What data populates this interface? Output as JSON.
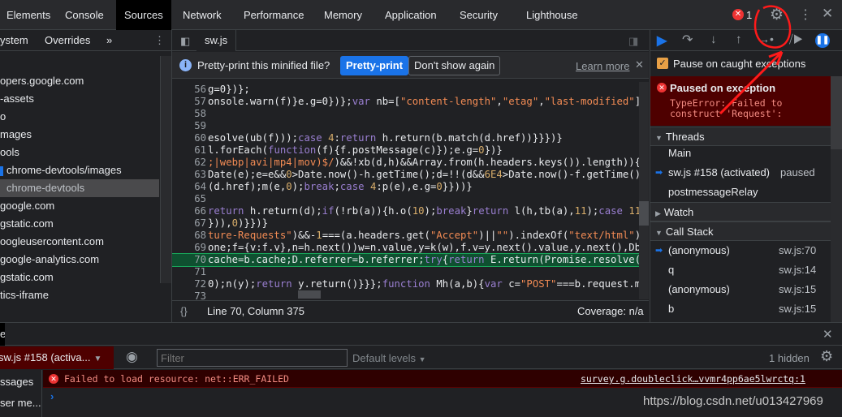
{
  "tabs": [
    "Elements",
    "Console",
    "Sources",
    "Network",
    "Performance",
    "Memory",
    "Application",
    "Security",
    "Lighthouse"
  ],
  "active_tab": "Sources",
  "error_count": "1",
  "navigator": {
    "subtabs": [
      "ystem",
      "Overrides"
    ],
    "more": "»",
    "items": [
      "opers.google.com",
      "-assets",
      "o",
      "mages",
      "ools",
      "chrome-devtools/images",
      "chrome-devtools",
      "google.com",
      "gstatic.com",
      "oogleusercontent.com",
      "google-analytics.com",
      "gstatic.com",
      "tics-iframe"
    ],
    "selected_index": 6
  },
  "editor": {
    "file_tab": "sw.js",
    "infobar": {
      "text": "Pretty-print this minified file?",
      "pretty_print": "Pretty-print",
      "dont_show": "Don't show again",
      "learn_more": "Learn more"
    },
    "lines": [
      {
        "n": "56",
        "t": [
          [
            "g=0})};",
            "ct"
          ]
        ]
      },
      {
        "n": "57",
        "t": [
          [
            "onsole.warn(f)}e.g=0})};",
            "ct"
          ],
          [
            "var ",
            "kw"
          ],
          [
            "nb=[",
            "ct"
          ],
          [
            "\"content-length\"",
            "st"
          ],
          [
            ",",
            "ct"
          ],
          [
            "\"etag\"",
            "st"
          ],
          [
            ",",
            "ct"
          ],
          [
            "\"last-modified\"",
            "st"
          ],
          [
            "]",
            "ct"
          ]
        ]
      },
      {
        "n": "58",
        "t": []
      },
      {
        "n": "59",
        "t": []
      },
      {
        "n": "60",
        "t": [
          [
            "esolve(ub(f)));",
            "ct"
          ],
          [
            "case ",
            "kw"
          ],
          [
            "4",
            "nm"
          ],
          [
            ":",
            "ct"
          ],
          [
            "return ",
            "kw"
          ],
          [
            "h.return(b.match(d.href))}}})}",
            "ct"
          ]
        ]
      },
      {
        "n": "61",
        "t": [
          [
            "l.forEach(",
            "ct"
          ],
          [
            "function",
            "kw"
          ],
          [
            "(f){f.postMessage(c)});e.g=",
            "ct"
          ],
          [
            "0",
            "nm"
          ],
          [
            "})}",
            "ct"
          ]
        ]
      },
      {
        "n": "62",
        "t": [
          [
            ";|webp|avi|mp4|mov)$/",
            "st"
          ],
          [
            ")&&!xb(d,h)&&Array.from(h.headers.keys()).length)){v",
            "ct"
          ]
        ]
      },
      {
        "n": "63",
        "t": [
          [
            "Date(e);e=e&&",
            "ct"
          ],
          [
            "0",
            "nm"
          ],
          [
            ">Date.now()-h.getTime();d=!!(d&&",
            "ct"
          ],
          [
            "6E4",
            "nm"
          ],
          [
            ">Date.now()-f.getTime()",
            "ct"
          ]
        ]
      },
      {
        "n": "64",
        "t": [
          [
            "(d.href);m(e,",
            "ct"
          ],
          [
            "0",
            "nm"
          ],
          [
            ");",
            "ct"
          ],
          [
            "break",
            "kw"
          ],
          [
            ";",
            "ct"
          ],
          [
            "case ",
            "kw"
          ],
          [
            "4",
            "nm"
          ],
          [
            ":p(e),e.g=",
            "ct"
          ],
          [
            "0",
            "nm"
          ],
          [
            "}}))}",
            "ct"
          ]
        ]
      },
      {
        "n": "65",
        "t": []
      },
      {
        "n": "66",
        "t": [
          [
            "return ",
            "kw"
          ],
          [
            "h.return(d);",
            "ct"
          ],
          [
            "if",
            "kw"
          ],
          [
            "(!rb(a)){h.o(",
            "ct"
          ],
          [
            "10",
            "nm"
          ],
          [
            ");",
            "ct"
          ],
          [
            "break",
            "kw"
          ],
          [
            "}",
            "ct"
          ],
          [
            "return ",
            "kw"
          ],
          [
            "l(h,tb(a),",
            "ct"
          ],
          [
            "11",
            "nm"
          ],
          [
            ");",
            "ct"
          ],
          [
            "case ",
            "kw"
          ],
          [
            "11",
            "nm"
          ]
        ]
      },
      {
        "n": "67",
        "t": [
          [
            "})),",
            "ct"
          ],
          [
            "0",
            "nm"
          ],
          [
            ")}})}",
            "ct"
          ]
        ]
      },
      {
        "n": "68",
        "t": [
          [
            "ture-Requests\"",
            "st"
          ],
          [
            ")&&-",
            "ct"
          ],
          [
            "1",
            "nm"
          ],
          [
            "===(a.headers.get(",
            "ct"
          ],
          [
            "\"Accept\"",
            "st"
          ],
          [
            ")||",
            "ct"
          ],
          [
            "\"\"",
            "st"
          ],
          [
            ").indexOf(",
            "ct"
          ],
          [
            "\"text/html\"",
            "st"
          ],
          [
            "))",
            "ct"
          ]
        ]
      },
      {
        "n": "69",
        "t": [
          [
            "one;f={v:f.v},n=h.next())w=n.value,y=k(w),f.v=y.next().value,y.next(),Db.",
            "ct"
          ]
        ]
      },
      {
        "n": "70",
        "t": [
          [
            "cache=b.cache;D.referrer=b.referrer;",
            "ct"
          ],
          [
            "try",
            "kw"
          ],
          [
            "{",
            "ct"
          ],
          [
            "return ",
            "kw"
          ],
          [
            "E.return(Promise.resolve(n",
            "ct"
          ]
        ],
        "hl": true
      },
      {
        "n": "71",
        "t": []
      },
      {
        "n": "72",
        "t": [
          [
            "0);n(y);",
            "ct"
          ],
          [
            "return ",
            "kw"
          ],
          [
            "y.return()}}};",
            "ct"
          ],
          [
            "function ",
            "kw"
          ],
          [
            "Mh(a,b){",
            "ct"
          ],
          [
            "var ",
            "kw"
          ],
          [
            "c=",
            "ct"
          ],
          [
            "\"POST\"",
            "st"
          ],
          [
            "===b.request.m",
            "ct"
          ]
        ]
      },
      {
        "n": "73",
        "t": []
      }
    ],
    "status": {
      "position": "Line 70, Column 375",
      "coverage": "Coverage: n/a"
    }
  },
  "debugger": {
    "pause_on_caught": "Pause on caught exceptions",
    "pause_on_caught_checked": true,
    "paused_title": "Paused on exception",
    "paused_message": "TypeError: Failed to\nconstruct 'Request':",
    "threads_label": "Threads",
    "threads": [
      {
        "name": "Main",
        "status": ""
      },
      {
        "name": "sw.js #158 (activated)",
        "status": "paused",
        "current": true
      },
      {
        "name": "postmessageRelay",
        "status": ""
      }
    ],
    "watch_label": "Watch",
    "callstack_label": "Call Stack",
    "frames": [
      {
        "name": "(anonymous)",
        "loc": "sw.js:70",
        "current": true
      },
      {
        "name": "q",
        "loc": "sw.js:14"
      },
      {
        "name": "(anonymous)",
        "loc": "sw.js:15"
      },
      {
        "name": "b",
        "loc": "sw.js:15"
      }
    ]
  },
  "drawer": {
    "tab": "e",
    "context": "sw.js #158 (activa...",
    "filter_placeholder": "Filter",
    "levels": "Default levels",
    "hidden": "1 hidden",
    "sidebar": [
      "ssages",
      "ser me..."
    ],
    "error_text": "Failed to load resource: net::ERR_FAILED",
    "error_source": "survey.g.doubleclick…vvmr4pp6ae5lwrctq:1"
  },
  "watermark": "https://blog.csdn.net/u013427969",
  "colors": {
    "accent": "#1a73e8",
    "error_bg": "#4e0000",
    "error_text": "#f28b82",
    "annotation": "#ff1a1a"
  }
}
